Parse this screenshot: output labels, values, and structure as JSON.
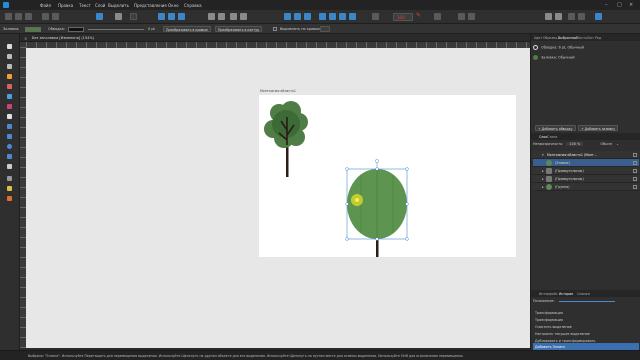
{
  "menu": {
    "items": [
      "Файл",
      "Правка",
      "Текст",
      "Слой",
      "Выделить",
      "Представление",
      "Окно",
      "Справка"
    ]
  },
  "toolbar": {
    "zoom_value": "100"
  },
  "context_bar": {
    "fill_label": "Заливка:",
    "stroke_label": "Обводка:",
    "stroke_width": "0 pt",
    "convert_to_curves": "Преобразовать в кривые",
    "convert_to_shape": "Преобразовать в контур",
    "align_label": "Выровнять по кривым"
  },
  "document": {
    "tab_title": "Без заголовка [Изменено] (154%)",
    "artboard_label": "Монтажная область1"
  },
  "right_panel": {
    "top_tabs": [
      "Цвет",
      "Образец",
      "Выбранный",
      "Кисть",
      "Лин",
      "Ред"
    ],
    "stroke_row": "Обводка: 6 pt, Обычный",
    "fill_row": "Заливка: Обычный",
    "add_stroke_button": "+ Добавить обводку",
    "add_fill_button": "+ Добавить заливку",
    "layers_tabs": [
      "Слои",
      "Стили"
    ],
    "opacity_label": "Непрозрачность:",
    "opacity_value": "100 %",
    "blend_mode": "Обычн",
    "layers": [
      {
        "name": "Монтажная область1 (Монт...",
        "selected": false
      },
      {
        "name": "(Эллипс)",
        "selected": true
      },
      {
        "name": "(Прямоугольник)",
        "selected": false
      },
      {
        "name": "(Прямоугольник)",
        "selected": false
      },
      {
        "name": "(Группа)",
        "selected": false
      }
    ],
    "bottom_tabs": [
      "Интерфейс",
      "История",
      "Снимки"
    ],
    "history_label": "Положение:",
    "history": [
      "Трансформация",
      "Трансформация",
      "Очистить выделение",
      "Настроить текущее выделение",
      "Дублировать и трансформировать",
      "Добавить Эллипс"
    ],
    "history_selected_index": 5
  },
  "status": {
    "text": "Выбрано: \"Эллипс\". Используйте Перетащить для перемещения выделения. Используйте Щелкнуть на другом объекте для его выделения. Используйте Щелкнуть на пустом месте для отмены выделения. Используйте Shift для ограничения перемещения."
  },
  "colors": {
    "accent": "#3b86c8",
    "tree_foliage": "#4f7d45",
    "tree_foliage_dark": "#3c6b38",
    "trunk": "#2b1c14",
    "ellipse_fill": "#5c9450",
    "selection_box": "#4a8ad4",
    "highlight": "#e3e01f"
  }
}
